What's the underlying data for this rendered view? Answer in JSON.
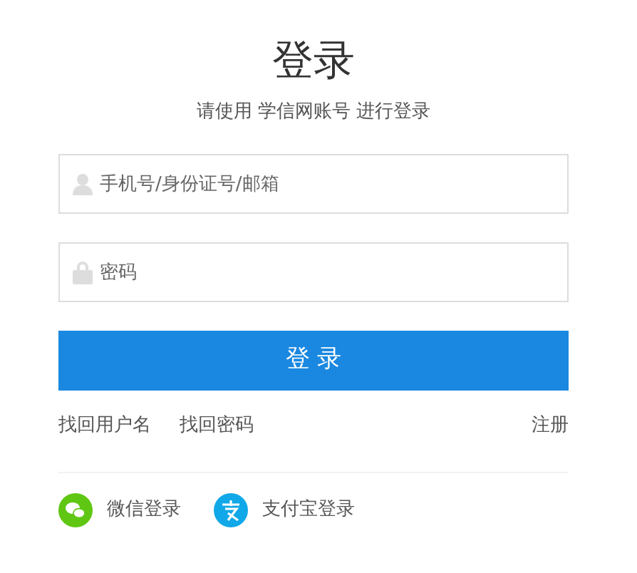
{
  "title": "登录",
  "subtitle": "请使用 学信网账号 进行登录",
  "fields": [
    {
      "kind": "user",
      "placeholder": "手机号/身份证号/邮箱"
    },
    {
      "kind": "lock",
      "placeholder": "密码"
    }
  ],
  "submit": "登 录",
  "links": [
    "找回用户名",
    "找回密码"
  ],
  "register": "注册",
  "social": [
    {
      "kind": "wechat",
      "label": "微信登录"
    },
    {
      "kind": "alipay",
      "label": "支付宝登录"
    }
  ]
}
